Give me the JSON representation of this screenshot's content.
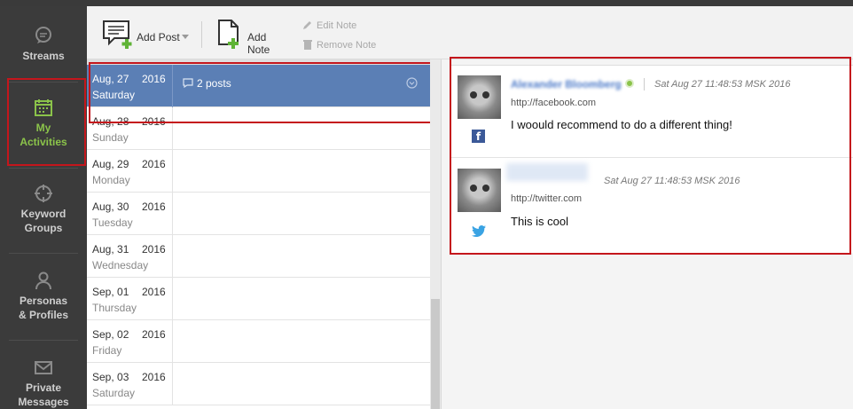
{
  "sidebar": {
    "items": [
      {
        "label_line1": "Streams",
        "label_line2": ""
      },
      {
        "label_line1": "My",
        "label_line2": "Activities"
      },
      {
        "label_line1": "Keyword",
        "label_line2": "Groups"
      },
      {
        "label_line1": "Personas",
        "label_line2": "& Profiles"
      },
      {
        "label_line1": "Private",
        "label_line2": "Messages"
      }
    ],
    "accent": "#8bc34a"
  },
  "toolbar": {
    "add_post": "Add Post",
    "add_note": "Add Note",
    "edit_note": "Edit Note",
    "remove_note": "Remove Note"
  },
  "calendar": {
    "rows": [
      {
        "date": "Aug, 27",
        "year": "2016",
        "day": "Saturday",
        "posts": "2 posts"
      },
      {
        "date": "Aug, 28",
        "year": "2016",
        "day": "Sunday"
      },
      {
        "date": "Aug, 29",
        "year": "2016",
        "day": "Monday"
      },
      {
        "date": "Aug, 30",
        "year": "2016",
        "day": "Tuesday"
      },
      {
        "date": "Aug, 31",
        "year": "2016",
        "day": "Wednesday"
      },
      {
        "date": "Sep, 01",
        "year": "2016",
        "day": "Thursday"
      },
      {
        "date": "Sep, 02",
        "year": "2016",
        "day": "Friday"
      },
      {
        "date": "Sep, 03",
        "year": "2016",
        "day": "Saturday"
      }
    ],
    "selected_color": "#5b7fb5"
  },
  "feed": {
    "posts": [
      {
        "author": "Alexander Bloomberg",
        "timestamp": "Sat Aug 27 11:48:53 MSK 2016",
        "url": "http://facebook.com",
        "text": "I woould recommend to do a different thing!",
        "network_icon": "facebook-icon"
      },
      {
        "author": "",
        "timestamp": "Sat Aug 27 11:48:53 MSK 2016",
        "url": "http://twitter.com",
        "text": "This is cool",
        "network_icon": "twitter-icon"
      }
    ]
  },
  "highlight_color": "#c4161c"
}
